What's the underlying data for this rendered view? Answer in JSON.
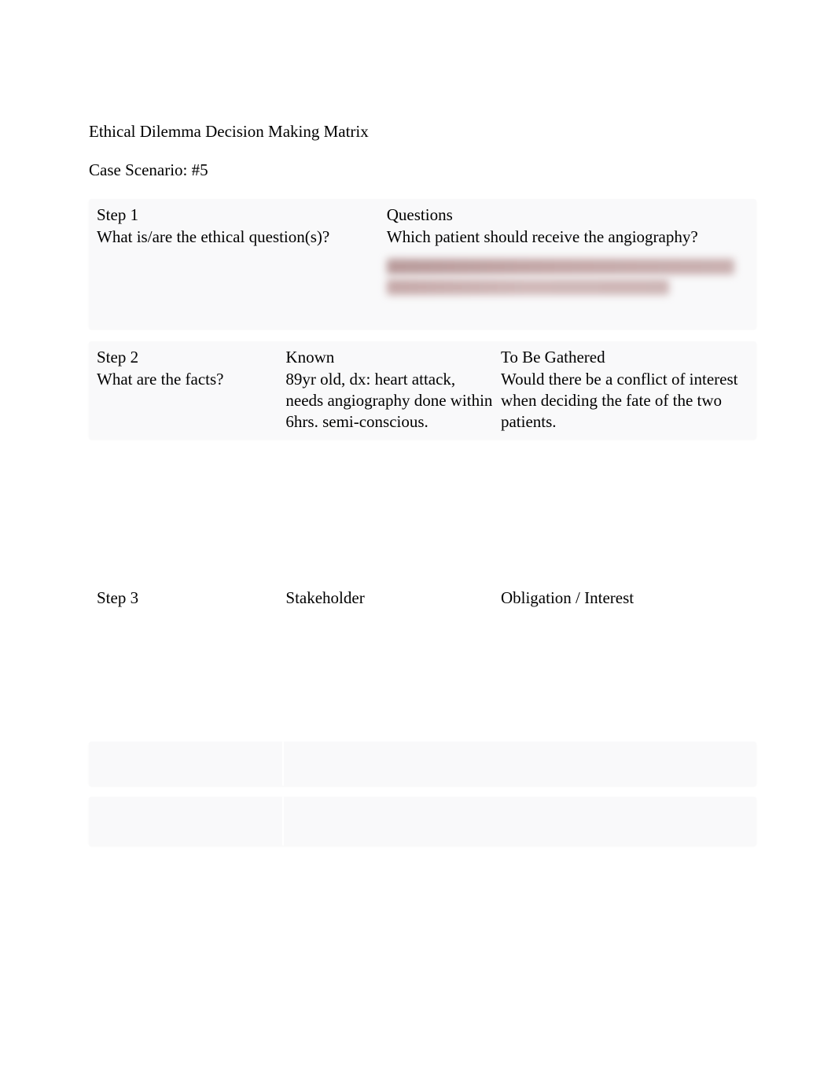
{
  "title": "Ethical Dilemma Decision Making Matrix",
  "subtitle": "Case Scenario: #5",
  "step1": {
    "step_label": "Step 1",
    "prompt": "What is/are the ethical question(s)?",
    "heading": "Questions",
    "answer": "Which patient should receive the angiography?"
  },
  "step2": {
    "step_label": "Step 2",
    "prompt": "What are the facts?",
    "known_heading": "Known",
    "known_text": "89yr old, dx: heart attack, needs angiography done within 6hrs. semi-conscious.",
    "gathered_heading": "To Be Gathered",
    "gathered_text": "Would there be a conflict of interest when deciding the fate of the two patients."
  },
  "step3": {
    "step_label": "Step 3",
    "stakeholder_heading": "Stakeholder",
    "obligation_heading": "Obligation / Interest"
  }
}
